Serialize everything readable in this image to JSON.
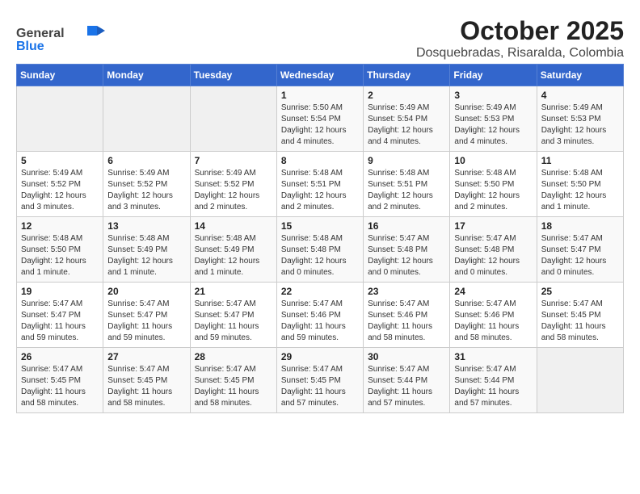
{
  "header": {
    "logo_general": "General",
    "logo_blue": "Blue",
    "title": "October 2025",
    "subtitle": "Dosquebradas, Risaralda, Colombia"
  },
  "columns": [
    "Sunday",
    "Monday",
    "Tuesday",
    "Wednesday",
    "Thursday",
    "Friday",
    "Saturday"
  ],
  "weeks": [
    [
      {
        "day": "",
        "info": ""
      },
      {
        "day": "",
        "info": ""
      },
      {
        "day": "",
        "info": ""
      },
      {
        "day": "1",
        "info": "Sunrise: 5:50 AM\nSunset: 5:54 PM\nDaylight: 12 hours\nand 4 minutes."
      },
      {
        "day": "2",
        "info": "Sunrise: 5:49 AM\nSunset: 5:54 PM\nDaylight: 12 hours\nand 4 minutes."
      },
      {
        "day": "3",
        "info": "Sunrise: 5:49 AM\nSunset: 5:53 PM\nDaylight: 12 hours\nand 4 minutes."
      },
      {
        "day": "4",
        "info": "Sunrise: 5:49 AM\nSunset: 5:53 PM\nDaylight: 12 hours\nand 3 minutes."
      }
    ],
    [
      {
        "day": "5",
        "info": "Sunrise: 5:49 AM\nSunset: 5:52 PM\nDaylight: 12 hours\nand 3 minutes."
      },
      {
        "day": "6",
        "info": "Sunrise: 5:49 AM\nSunset: 5:52 PM\nDaylight: 12 hours\nand 3 minutes."
      },
      {
        "day": "7",
        "info": "Sunrise: 5:49 AM\nSunset: 5:52 PM\nDaylight: 12 hours\nand 2 minutes."
      },
      {
        "day": "8",
        "info": "Sunrise: 5:48 AM\nSunset: 5:51 PM\nDaylight: 12 hours\nand 2 minutes."
      },
      {
        "day": "9",
        "info": "Sunrise: 5:48 AM\nSunset: 5:51 PM\nDaylight: 12 hours\nand 2 minutes."
      },
      {
        "day": "10",
        "info": "Sunrise: 5:48 AM\nSunset: 5:50 PM\nDaylight: 12 hours\nand 2 minutes."
      },
      {
        "day": "11",
        "info": "Sunrise: 5:48 AM\nSunset: 5:50 PM\nDaylight: 12 hours\nand 1 minute."
      }
    ],
    [
      {
        "day": "12",
        "info": "Sunrise: 5:48 AM\nSunset: 5:50 PM\nDaylight: 12 hours\nand 1 minute."
      },
      {
        "day": "13",
        "info": "Sunrise: 5:48 AM\nSunset: 5:49 PM\nDaylight: 12 hours\nand 1 minute."
      },
      {
        "day": "14",
        "info": "Sunrise: 5:48 AM\nSunset: 5:49 PM\nDaylight: 12 hours\nand 1 minute."
      },
      {
        "day": "15",
        "info": "Sunrise: 5:48 AM\nSunset: 5:48 PM\nDaylight: 12 hours\nand 0 minutes."
      },
      {
        "day": "16",
        "info": "Sunrise: 5:47 AM\nSunset: 5:48 PM\nDaylight: 12 hours\nand 0 minutes."
      },
      {
        "day": "17",
        "info": "Sunrise: 5:47 AM\nSunset: 5:48 PM\nDaylight: 12 hours\nand 0 minutes."
      },
      {
        "day": "18",
        "info": "Sunrise: 5:47 AM\nSunset: 5:47 PM\nDaylight: 12 hours\nand 0 minutes."
      }
    ],
    [
      {
        "day": "19",
        "info": "Sunrise: 5:47 AM\nSunset: 5:47 PM\nDaylight: 11 hours\nand 59 minutes."
      },
      {
        "day": "20",
        "info": "Sunrise: 5:47 AM\nSunset: 5:47 PM\nDaylight: 11 hours\nand 59 minutes."
      },
      {
        "day": "21",
        "info": "Sunrise: 5:47 AM\nSunset: 5:47 PM\nDaylight: 11 hours\nand 59 minutes."
      },
      {
        "day": "22",
        "info": "Sunrise: 5:47 AM\nSunset: 5:46 PM\nDaylight: 11 hours\nand 59 minutes."
      },
      {
        "day": "23",
        "info": "Sunrise: 5:47 AM\nSunset: 5:46 PM\nDaylight: 11 hours\nand 58 minutes."
      },
      {
        "day": "24",
        "info": "Sunrise: 5:47 AM\nSunset: 5:46 PM\nDaylight: 11 hours\nand 58 minutes."
      },
      {
        "day": "25",
        "info": "Sunrise: 5:47 AM\nSunset: 5:45 PM\nDaylight: 11 hours\nand 58 minutes."
      }
    ],
    [
      {
        "day": "26",
        "info": "Sunrise: 5:47 AM\nSunset: 5:45 PM\nDaylight: 11 hours\nand 58 minutes."
      },
      {
        "day": "27",
        "info": "Sunrise: 5:47 AM\nSunset: 5:45 PM\nDaylight: 11 hours\nand 58 minutes."
      },
      {
        "day": "28",
        "info": "Sunrise: 5:47 AM\nSunset: 5:45 PM\nDaylight: 11 hours\nand 58 minutes."
      },
      {
        "day": "29",
        "info": "Sunrise: 5:47 AM\nSunset: 5:45 PM\nDaylight: 11 hours\nand 57 minutes."
      },
      {
        "day": "30",
        "info": "Sunrise: 5:47 AM\nSunset: 5:44 PM\nDaylight: 11 hours\nand 57 minutes."
      },
      {
        "day": "31",
        "info": "Sunrise: 5:47 AM\nSunset: 5:44 PM\nDaylight: 11 hours\nand 57 minutes."
      },
      {
        "day": "",
        "info": ""
      }
    ]
  ]
}
